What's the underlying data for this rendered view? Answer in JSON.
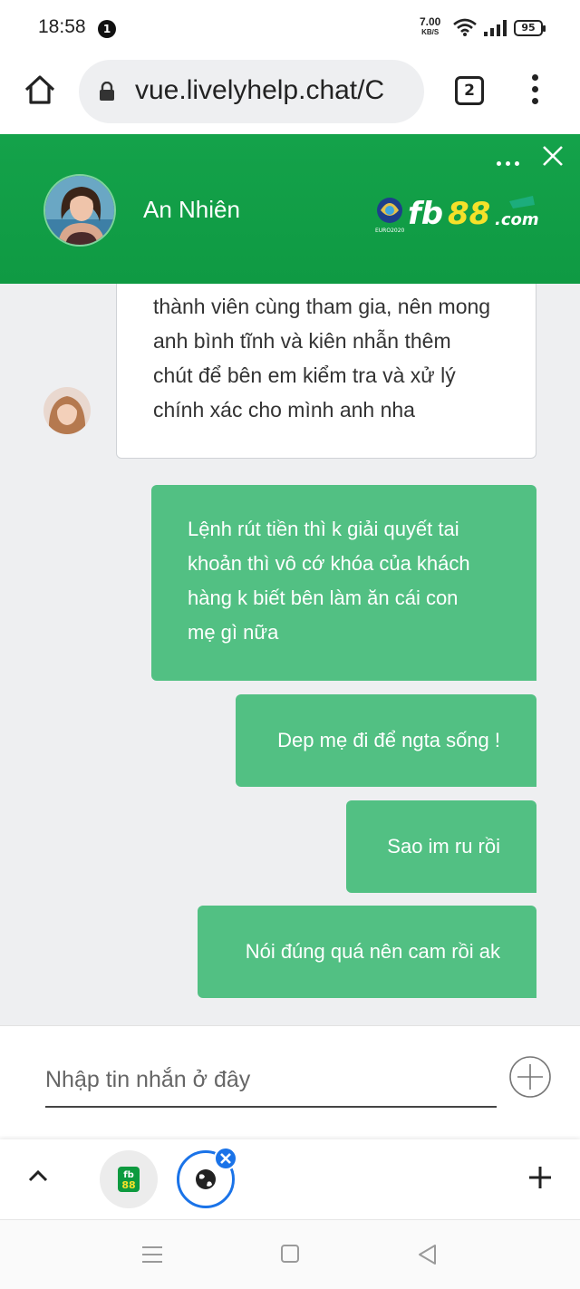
{
  "status_bar": {
    "time": "18:58",
    "notification_count": "1",
    "net_speed_value": "7.00",
    "net_speed_unit": "KB/S",
    "battery": "95"
  },
  "browser": {
    "url": "vue.livelyhelp.chat/C",
    "tab_count": "2"
  },
  "chat_header": {
    "agent_name": "An Nhiên",
    "brand_text": "fb88",
    "brand_suffix": ".com",
    "brand_small": "EURO2020",
    "accent_color": "#129f47"
  },
  "messages": {
    "agent": [
      {
        "lines": [
          "thành viên cùng tham gia, nên mong",
          "anh bình tĩnh và kiên nhẫn thêm",
          "chút để bên em kiểm tra và xử lý",
          "chính xác cho mình anh nha"
        ]
      }
    ],
    "user": [
      {
        "lines": [
          "Lệnh rút tiền thì k giải quyết tai",
          "khoản thì vô cớ khóa của khách",
          "hàng k biết bên làm ăn cái con",
          "mẹ gì nữa"
        ]
      },
      {
        "text": "Dep mẹ đi để ngta sống !"
      },
      {
        "text": "Sao im ru rồi"
      },
      {
        "text": "Nói đúng quá nên cam rồi ak"
      }
    ],
    "user_bubble_color": "#52c083"
  },
  "composer": {
    "placeholder": "Nhập tin nhắn ở đây"
  },
  "tab_strip": {
    "fb_tab_label": "fb88"
  }
}
